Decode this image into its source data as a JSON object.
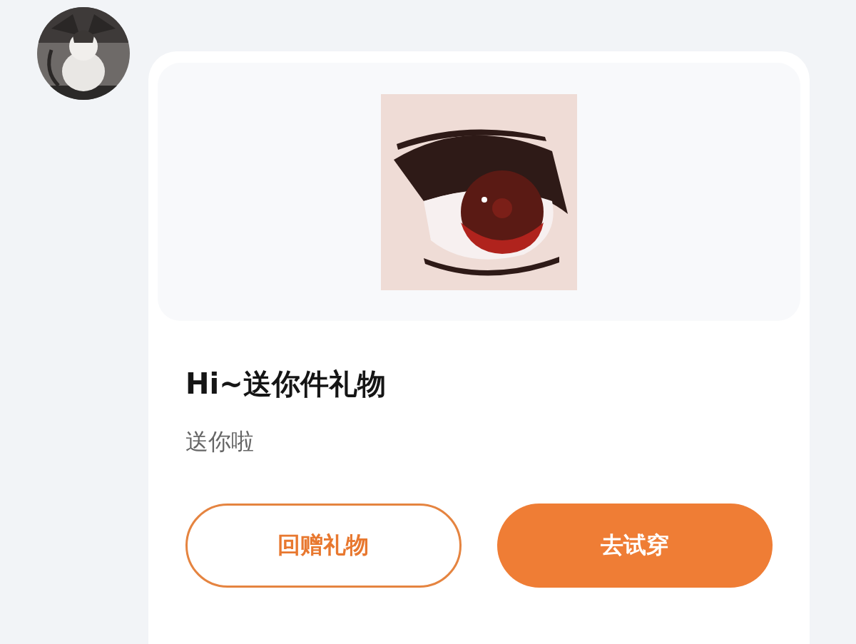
{
  "gift_card": {
    "title": "Hi~送你件礼物",
    "message": "送你啦",
    "buttons": [
      {
        "label": "回赠礼物",
        "kind": "outline"
      },
      {
        "label": "去试穿",
        "kind": "filled"
      }
    ]
  }
}
